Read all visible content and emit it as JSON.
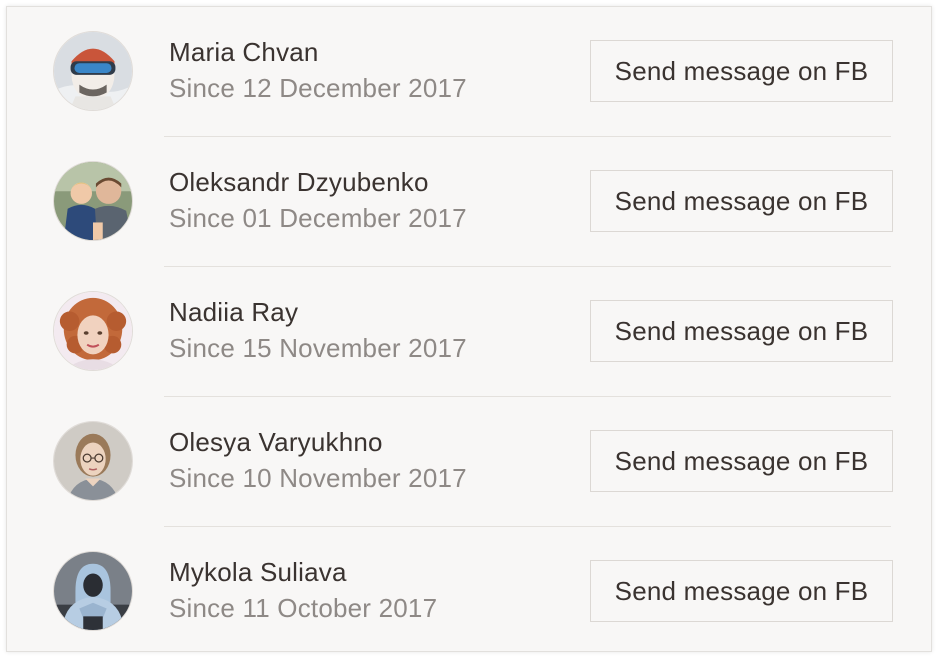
{
  "contacts": [
    {
      "name": "Maria Chvan",
      "since": "Since 12 December 2017",
      "button_label": "Send message on FB",
      "avatar_icon": "avatar-photo-skier"
    },
    {
      "name": "Oleksandr Dzyubenko",
      "since": "Since 01 December 2017",
      "button_label": "Send message on FB",
      "avatar_icon": "avatar-photo-father-child"
    },
    {
      "name": "Nadiia Ray",
      "since": "Since 15 November 2017",
      "button_label": "Send message on FB",
      "avatar_icon": "avatar-photo-woman-curly"
    },
    {
      "name": "Olesya Varyukhno",
      "since": "Since 10 November 2017",
      "button_label": "Send message on FB",
      "avatar_icon": "avatar-photo-woman-glasses"
    },
    {
      "name": "Mykola Suliava",
      "since": "Since 11 October 2017",
      "button_label": "Send message on FB",
      "avatar_icon": "avatar-photo-hooded-man"
    }
  ],
  "colors": {
    "card_background": "#f8f7f6",
    "name_text": "#3a3330",
    "since_text": "#8e8986",
    "border": "#dcd8d4"
  }
}
